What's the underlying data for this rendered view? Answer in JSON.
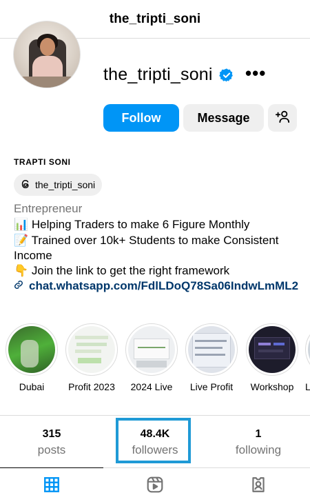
{
  "header": {
    "title": "the_tripti_soni"
  },
  "profile": {
    "username": "the_tripti_soni",
    "verified": true,
    "follow_label": "Follow",
    "message_label": "Message",
    "full_name": "TRAPTI SONI",
    "threads_handle": "the_tripti_soni",
    "category": "Entrepreneur",
    "bio_lines": [
      "📊 Helping Traders to make 6 Figure Monthly",
      "📝 Trained over 10k+ Students to make Consistent",
      "Income",
      "👇 Join the link to get the right framework"
    ],
    "link": "chat.whatsapp.com/FdlLDoQ78Sa06IndwLmML2"
  },
  "highlights": [
    {
      "label": "Dubai"
    },
    {
      "label": "Profit 2023"
    },
    {
      "label": "2024 Live"
    },
    {
      "label": "Live Profit"
    },
    {
      "label": "Workshop"
    },
    {
      "label": "L"
    }
  ],
  "stats": {
    "posts": {
      "value": "315",
      "label": "posts"
    },
    "followers": {
      "value": "48.4K",
      "label": "followers"
    },
    "following": {
      "value": "1",
      "label": "following"
    }
  },
  "colors": {
    "accent": "#0095f6",
    "link": "#00376b",
    "highlight_box": "#1f9ad6",
    "tab_active": "#0095f6"
  },
  "icons": {
    "verified": "verified-badge-icon",
    "more": "more-options-icon",
    "add_person": "add-person-icon",
    "threads": "threads-icon",
    "link": "link-icon",
    "grid": "grid-icon",
    "reels": "reels-icon",
    "tagged": "tagged-icon"
  }
}
